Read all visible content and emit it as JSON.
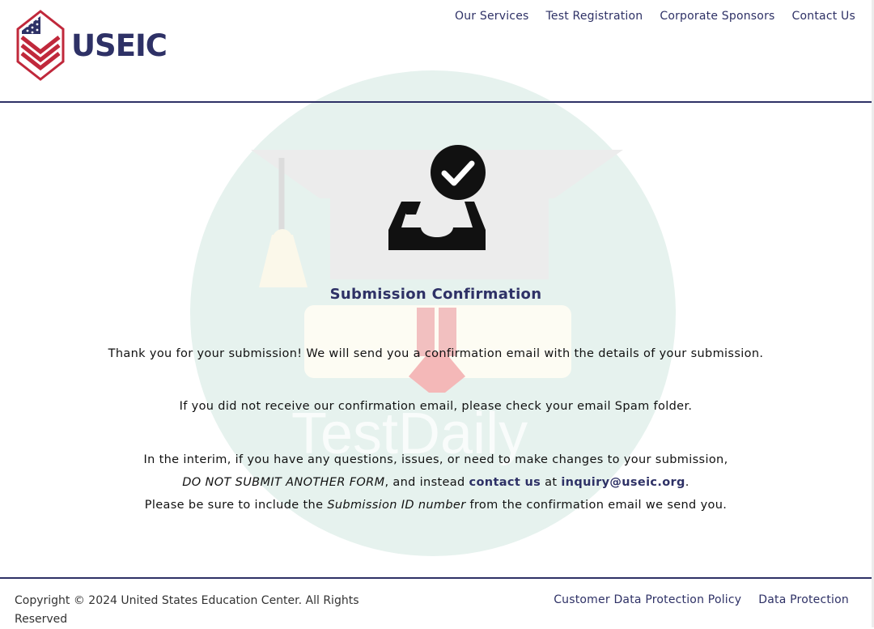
{
  "brand": {
    "name": "USEIC"
  },
  "nav": [
    {
      "label": "Our Services"
    },
    {
      "label": "Test Registration"
    },
    {
      "label": "Corporate Sponsors"
    },
    {
      "label": "Contact Us"
    }
  ],
  "watermark": {
    "text": "TestDaily"
  },
  "confirmation": {
    "icon": "inbox-check-icon",
    "title": "Submission Confirmation",
    "line1": "Thank you for your submission! We will send you a confirmation email with the details of your submission.",
    "line2": "If you did not receive our confirmation email, please check your email Spam folder.",
    "line3a": "In the interim, if you have any questions, issues, or need to make changes to your submission,",
    "line3b_em": "DO NOT SUBMIT ANOTHER FORM",
    "line3b_mid": ", and instead ",
    "contact_link": "contact us",
    "line3b_at": " at ",
    "email_link": "inquiry@useic.org",
    "line3b_end": ".",
    "line3c_start": "Please be sure to include the ",
    "line3c_em": "Submission ID number",
    "line3c_end": " from the confirmation email we send you."
  },
  "footer": {
    "copyright": "Copyright © 2024 United States Education Center. All Rights Reserved",
    "links": [
      {
        "label": "Customer Data Protection Policy"
      },
      {
        "label": "Data Protection"
      }
    ]
  },
  "colors": {
    "brand_navy": "#2e3166",
    "logo_red": "#c0283b",
    "watermark_mint": "#e6f2ee"
  }
}
